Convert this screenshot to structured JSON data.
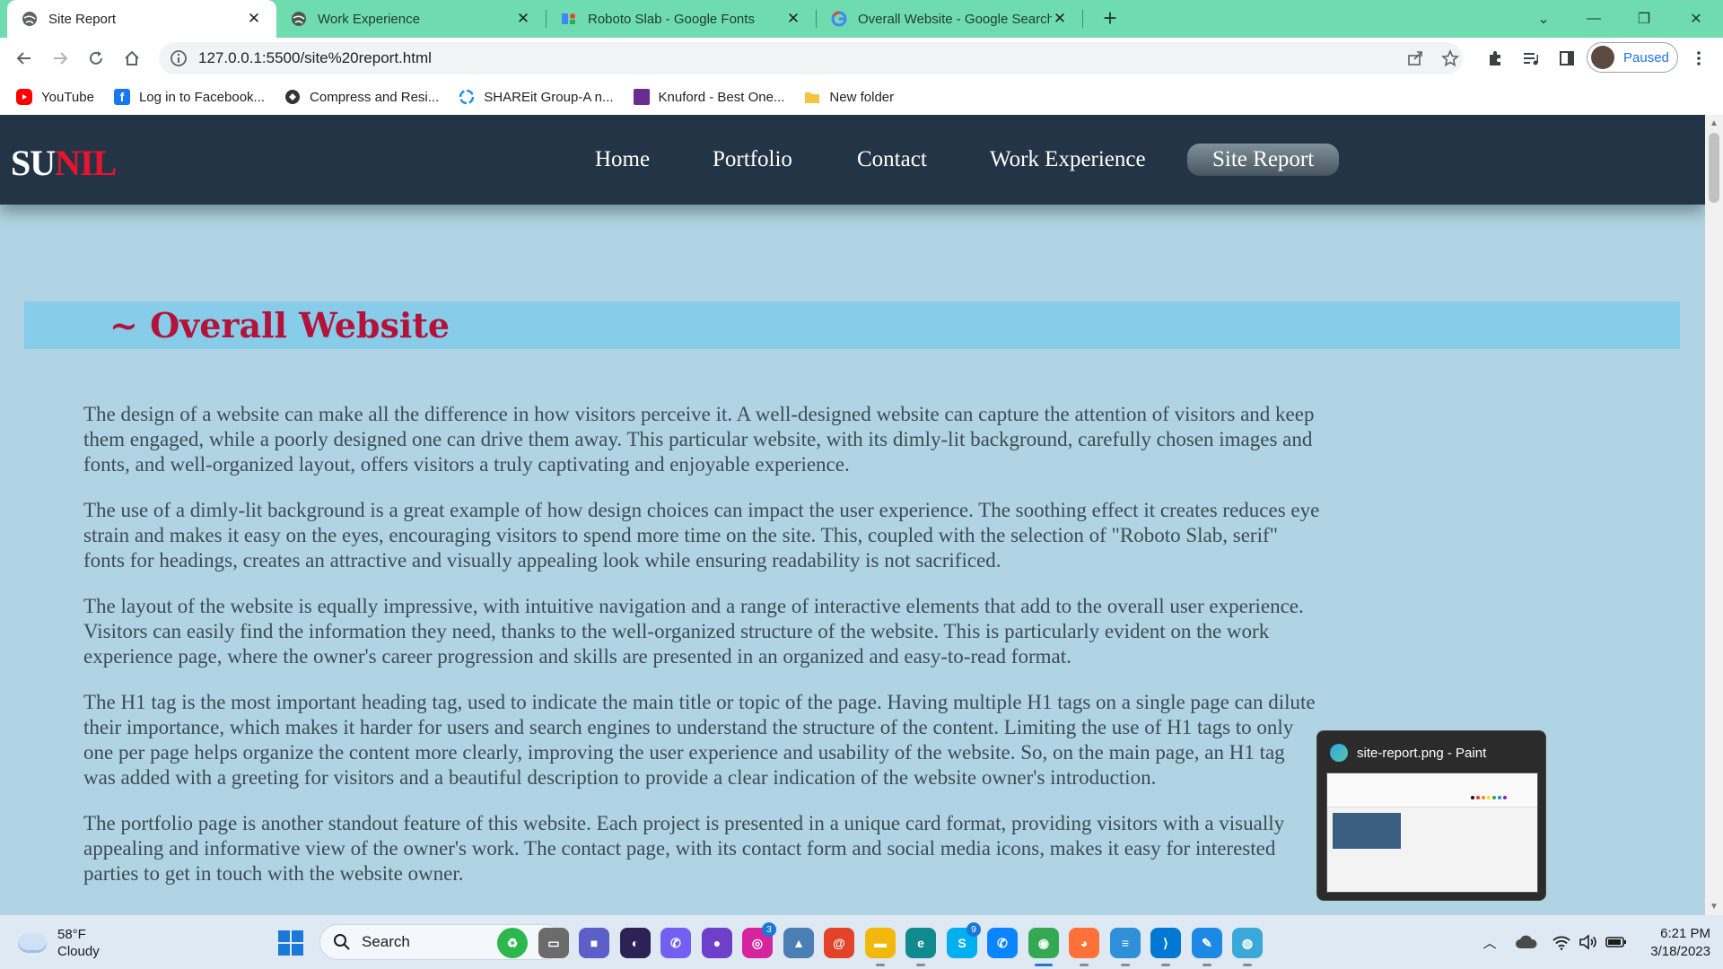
{
  "browser": {
    "tabs": [
      {
        "title": "Site Report",
        "icon": "globe-icon",
        "active": true
      },
      {
        "title": "Work Experience",
        "icon": "globe-icon",
        "active": false
      },
      {
        "title": "Roboto Slab - Google Fonts",
        "icon": "google-fonts-icon",
        "active": false
      },
      {
        "title": "Overall Website - Google Search",
        "icon": "google-icon",
        "active": false
      }
    ],
    "url": "127.0.0.1:5500/site%20report.html",
    "profile_status": "Paused",
    "bookmarks": [
      {
        "label": "YouTube",
        "icon": "youtube-icon",
        "color": "#ff0000"
      },
      {
        "label": "Log in to Facebook...",
        "icon": "facebook-icon",
        "color": "#1877f2"
      },
      {
        "label": "Compress and Resi...",
        "icon": "compress-icon",
        "color": "#333333"
      },
      {
        "label": "SHAREit Group-A n...",
        "icon": "shareit-icon",
        "color": "#1a8ee6"
      },
      {
        "label": "Knuford - Best One...",
        "icon": "knuford-icon",
        "color": "#6b2c91"
      },
      {
        "label": "New folder",
        "icon": "folder-icon",
        "color": "#f5c542"
      }
    ]
  },
  "site": {
    "logo_part1": "SU",
    "logo_part2": "NIL",
    "nav": [
      {
        "label": "Home",
        "active": false
      },
      {
        "label": "Portfolio",
        "active": false
      },
      {
        "label": "Contact",
        "active": false
      },
      {
        "label": "Work Experience",
        "active": false
      },
      {
        "label": "Site Report",
        "active": true
      }
    ],
    "heading": "~ Overall Website",
    "paragraphs": [
      "The design of a website can make all the difference in how visitors perceive it. A well-designed website can capture the attention of visitors and keep them engaged, while a poorly designed one can drive them away. This particular website, with its dimly-lit background, carefully chosen images and fonts, and well-organized layout, offers visitors a truly captivating and enjoyable experience.",
      "The use of a dimly-lit background is a great example of how design choices can impact the user experience. The soothing effect it creates reduces eye strain and makes it easy on the eyes, encouraging visitors to spend more time on the site. This, coupled with the selection of \"Roboto Slab, serif\" fonts for headings, creates an attractive and visually appealing look while ensuring readability is not sacrificed.",
      "The layout of the website is equally impressive, with intuitive navigation and a range of interactive elements that add to the overall user experience. Visitors can easily find the information they need, thanks to the well-organized structure of the website. This is particularly evident on the work experience page, where the owner's career progression and skills are presented in an organized and easy-to-read format.",
      "The H1 tag is the most important heading tag, used to indicate the main title or topic of the page. Having multiple H1 tags on a single page can dilute their importance, which makes it harder for users and search engines to understand the structure of the content. Limiting the use of H1 tags to only one per page helps organize the content more clearly, improving the user experience and usability of the website. So, on the main page, an H1 tag was added with a greeting for visitors and a beautiful description to provide a clear indication of the website owner's introduction.",
      "The portfolio page is another standout feature of this website. Each project is presented in a unique card format, providing visitors with a visually appealing and informative view of the owner's work. The contact page, with its contact form and social media icons, makes it easy for interested parties to get in touch with the website owner."
    ]
  },
  "preview": {
    "title": "site-report.png - Paint"
  },
  "taskbar": {
    "weather_temp": "58°F",
    "weather_desc": "Cloudy",
    "search_label": "Search",
    "apps": [
      {
        "name": "recycle-app-icon",
        "label": "♻",
        "color": "#2db84d"
      },
      {
        "name": "task-view-icon",
        "label": "▭",
        "color": "#6b6b6b"
      },
      {
        "name": "meet-icon",
        "label": "■",
        "color": "#5b5fc7"
      },
      {
        "name": "eclipse-icon",
        "label": "◐",
        "color": "#2c2255"
      },
      {
        "name": "viber-icon",
        "label": "✆",
        "color": "#7360f2"
      },
      {
        "name": "github-icon",
        "label": "●",
        "color": "#6e40c9"
      },
      {
        "name": "instagram-icon",
        "label": "◎",
        "color": "#d6249f",
        "badge": "3"
      },
      {
        "name": "photos-icon",
        "label": "▲",
        "color": "#4a7fb5"
      },
      {
        "name": "swirl-app-icon",
        "label": "@",
        "color": "#e24329"
      },
      {
        "name": "file-explorer-icon",
        "label": "▬",
        "color": "#f2b90c"
      },
      {
        "name": "edge-icon",
        "label": "e",
        "color": "#0f8a8f"
      },
      {
        "name": "skype-icon",
        "label": "S",
        "color": "#00aff0",
        "badge": "9"
      },
      {
        "name": "phone-icon",
        "label": "✆",
        "color": "#0a84ff"
      },
      {
        "name": "chrome-icon",
        "label": "◉",
        "color": "#34a853"
      },
      {
        "name": "firefox-icon",
        "label": "◕",
        "color": "#ff7139"
      },
      {
        "name": "notepad-icon",
        "label": "≡",
        "color": "#2f8fd8"
      },
      {
        "name": "vscode-icon",
        "label": "⟩",
        "color": "#0078d4"
      },
      {
        "name": "paint-icon",
        "label": "✎",
        "color": "#1e88e5"
      },
      {
        "name": "globe-app-icon",
        "label": "◍",
        "color": "#3aa8d8"
      }
    ],
    "time": "6:21 PM",
    "date": "3/18/2023"
  }
}
